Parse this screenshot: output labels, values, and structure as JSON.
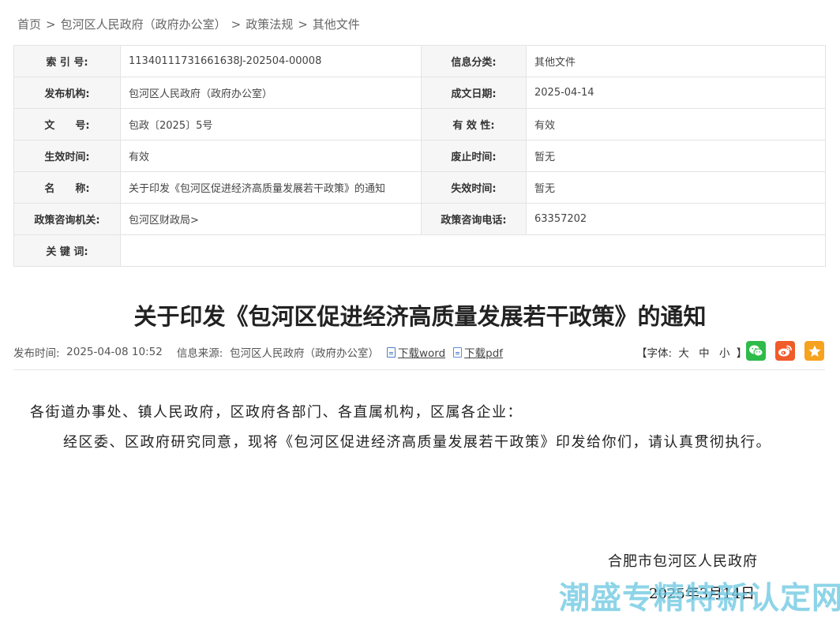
{
  "breadcrumb": {
    "items": [
      "首页",
      "包河区人民政府（政府办公室）",
      "政策法规",
      "其他文件"
    ],
    "separator": ">"
  },
  "meta": {
    "index_label": "索 引 号:",
    "index_value": "11340111731661638J-202504-00008",
    "category_label": "信息分类:",
    "category_value": "其他文件",
    "issuer_label": "发布机构:",
    "issuer_value": "包河区人民政府（政府办公室）",
    "written_date_label": "成文日期:",
    "written_date_value": "2025-04-14",
    "doc_no_label": "文　　号:",
    "doc_no_value": "包政〔2025〕5号",
    "validity_label": "有 效 性:",
    "validity_value": "有效",
    "effective_label": "生效时间:",
    "effective_value": "有效",
    "abolish_label": "废止时间:",
    "abolish_value": "暂无",
    "name_label": "名　　称:",
    "name_value": "关于印发《包河区促进经济高质量发展若干政策》的通知",
    "expire_label": "失效时间:",
    "expire_value": "暂无",
    "consult_org_label": "政策咨询机关:",
    "consult_org_value": "包河区财政局>",
    "consult_phone_label": "政策咨询电话:",
    "consult_phone_value": "63357202",
    "keywords_label": "关 键 词:",
    "keywords_value": ""
  },
  "article": {
    "title": "关于印发《包河区促进经济高质量发展若干政策》的通知",
    "publish_label": "发布时间:",
    "publish_time": "2025-04-08 10:52",
    "source_label": "信息来源:",
    "source_value": "包河区人民政府（政府办公室）",
    "download_word": "下载word",
    "download_pdf": "下载pdf",
    "font_label": "【字体:",
    "font_large": "大",
    "font_medium": "中",
    "font_small": "小",
    "font_close": "】",
    "salutation": "各街道办事处、镇人民政府，区政府各部门、各直属机构，区属各企业：",
    "paragraph": "经区委、区政府研究同意，现将《包河区促进经济高质量发展若干政策》印发给你们，请认真贯彻执行。",
    "sign_org": "合肥市包河区人民政府",
    "sign_date": "2025年3月14日"
  },
  "share": {
    "icons": [
      "wechat-icon",
      "weibo-icon",
      "favorite-icon"
    ],
    "colors": {
      "wechat": "#2fbb4a",
      "weibo": "#f05b2a",
      "favorite": "#f6a21f"
    }
  },
  "watermark": "潮盛专精特新认定网"
}
